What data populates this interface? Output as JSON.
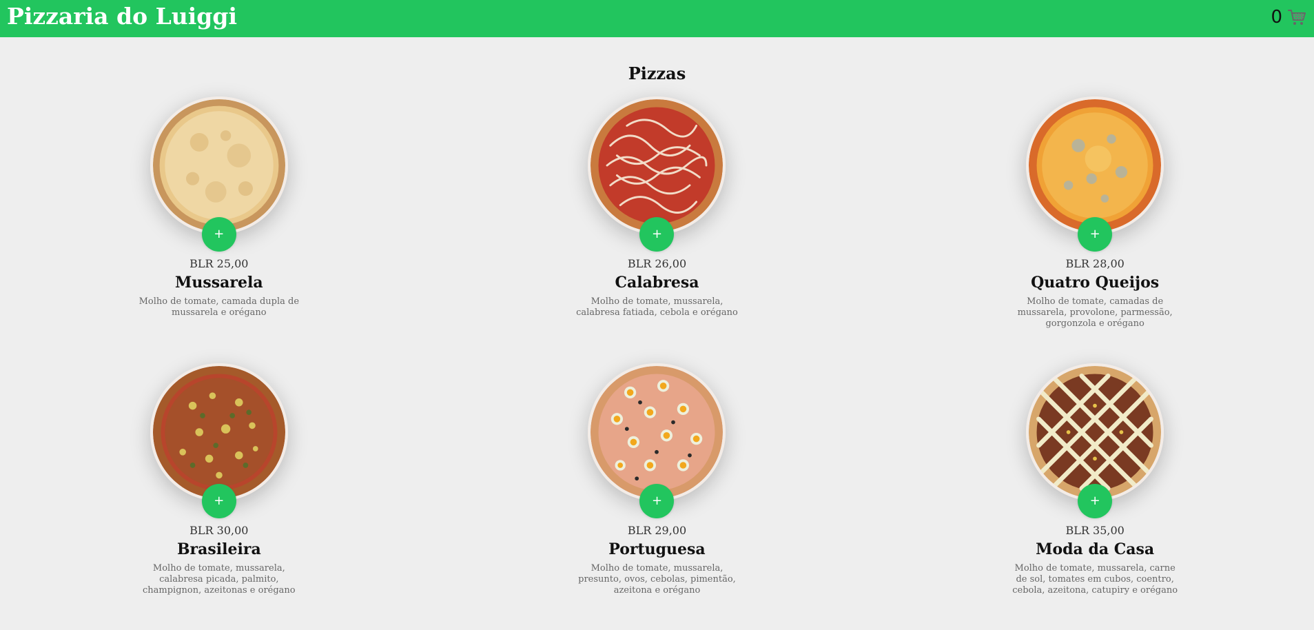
{
  "header": {
    "brand": "Pizzaria do Luiggi",
    "cart_count": "0",
    "cart_icon": "cart-icon",
    "brand_color": "#22c55e"
  },
  "section": {
    "title": "Pizzas"
  },
  "add_label": "+",
  "pizzas": [
    {
      "name": "Mussarela",
      "price": "BLR 25,00",
      "description": "Molho de tomate, camada dupla de mussarela e orégano"
    },
    {
      "name": "Calabresa",
      "price": "BLR 26,00",
      "description": "Molho de tomate, mussarela, calabresa fatiada, cebola e orégano"
    },
    {
      "name": "Quatro Queijos",
      "price": "BLR 28,00",
      "description": "Molho de tomate, camadas de mussarela, provolone, parmessão, gorgonzola e orégano"
    },
    {
      "name": "Brasileira",
      "price": "BLR 30,00",
      "description": "Molho de tomate, mussarela, calabresa picada, palmito, champignon, azeitonas e orégano"
    },
    {
      "name": "Portuguesa",
      "price": "BLR 29,00",
      "description": "Molho de tomate, mussarela, presunto, ovos, cebolas, pimentão, azeitona e orégano"
    },
    {
      "name": "Moda da Casa",
      "price": "BLR 35,00",
      "description": "Molho de tomate, mussarela, carne de sol, tomates em cubos, coentro, cebola, azeitona, catupiry e orégano"
    }
  ]
}
